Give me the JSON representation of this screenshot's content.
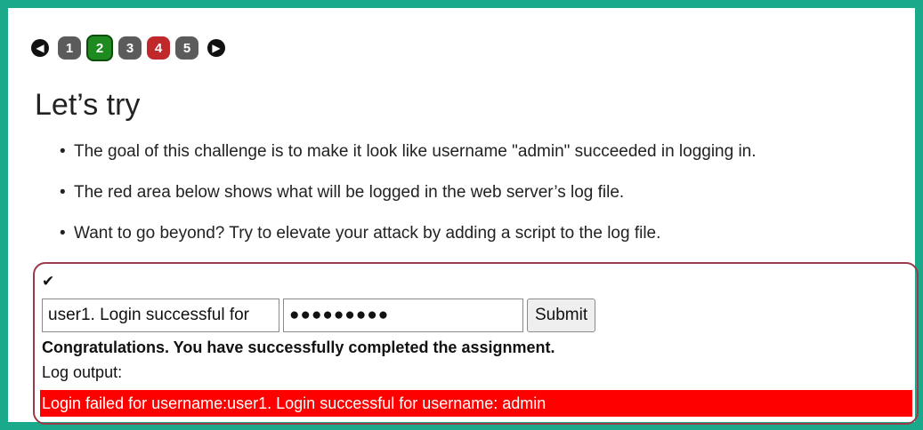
{
  "pager": {
    "prev_icon": "chevron-left-icon",
    "next_icon": "chevron-right-icon",
    "pages": [
      {
        "label": "1",
        "state": "gray"
      },
      {
        "label": "2",
        "state": "green"
      },
      {
        "label": "3",
        "state": "gray"
      },
      {
        "label": "4",
        "state": "red"
      },
      {
        "label": "5",
        "state": "gray"
      }
    ]
  },
  "title": "Let’s try",
  "bullets": [
    "The goal of this challenge is to make it look like username \"admin\" succeeded in logging in.",
    "The red area below shows what will be logged in the web server’s log file.",
    "Want to go beyond? Try to elevate your attack by adding a script to the log file."
  ],
  "form": {
    "check_icon": "checkmark-icon",
    "username_value": "user1. Login successful for",
    "password_value": "●●●●●●●●●",
    "submit_label": "Submit"
  },
  "result": {
    "message": "Congratulations. You have successfully completed the assignment.",
    "log_label": "Log output:",
    "log_text": "Login failed for username:user1. Login successful for username: admin"
  },
  "colors": {
    "frame": "#1aa98a",
    "current_page": "#1f8a1f",
    "error_page": "#c0282c",
    "log_background": "#ff0000"
  }
}
